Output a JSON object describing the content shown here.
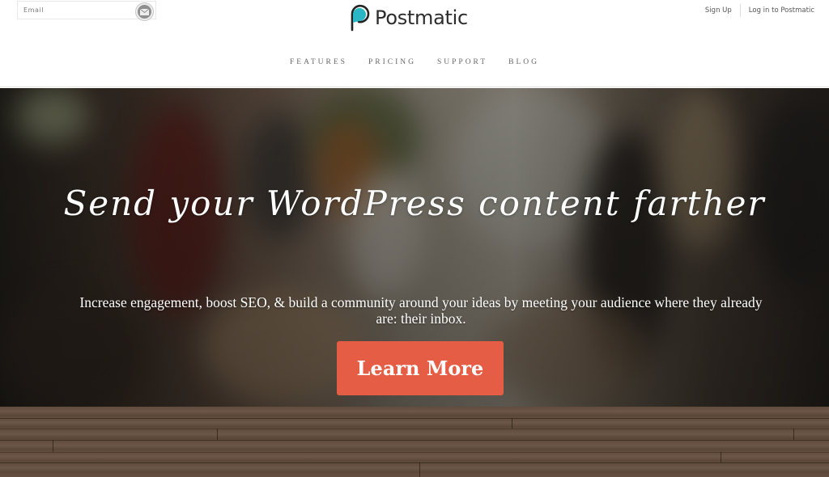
{
  "header": {
    "email_placeholder": "Email",
    "email_submit_icon": "envelope-icon",
    "logo_text": "Postmatic",
    "logo_icon": "postmatic-speech-bubble-logo",
    "logo_accent": "#2ab6c4",
    "top_links": [
      {
        "label": "Sign Up"
      },
      {
        "label": "Log in to Postmatic"
      }
    ],
    "nav": [
      {
        "label": "FEATURES"
      },
      {
        "label": "PRICING"
      },
      {
        "label": "SUPPORT"
      },
      {
        "label": "BLOG"
      }
    ]
  },
  "hero": {
    "headline": "Send your WordPress content farther",
    "subhead": "Increase engagement, boost SEO, & build a community around your ideas by meeting your audience where they already are: their inbox.",
    "cta_label": "Learn More",
    "cta_color": "#e65d45"
  }
}
